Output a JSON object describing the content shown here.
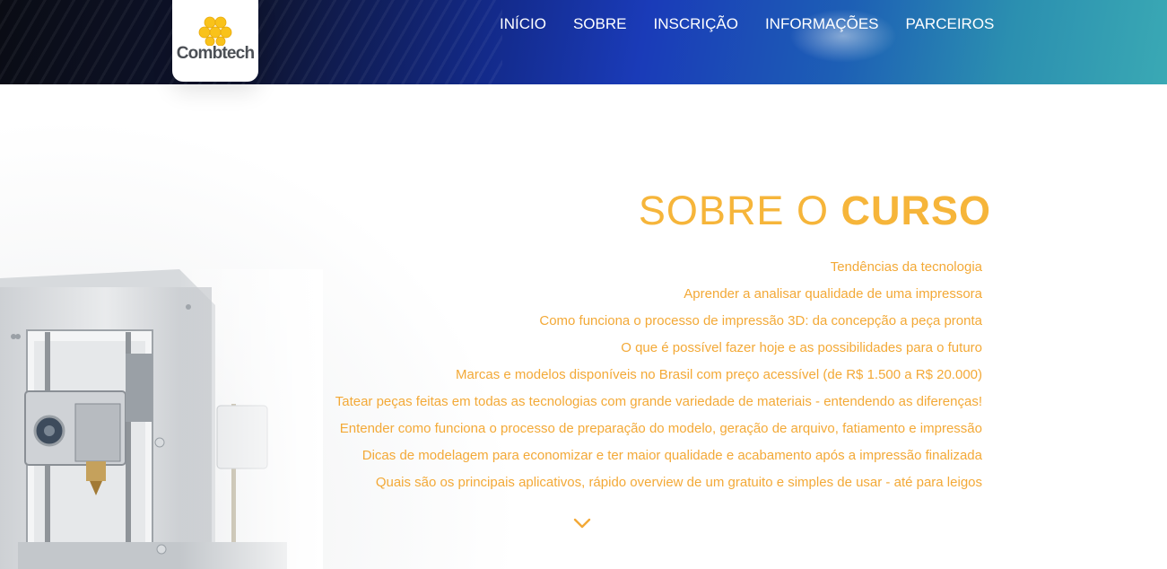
{
  "header": {
    "logo": {
      "text": "Combtech",
      "icon": "honeycomb-logo-icon",
      "accent_color": "#f9c21a"
    },
    "nav": [
      {
        "label": "INÍCIO"
      },
      {
        "label": "SOBRE"
      },
      {
        "label": "INSCRIÇÃO"
      },
      {
        "label": "INFORMAÇÕES"
      },
      {
        "label": "PARCEIROS"
      }
    ]
  },
  "about": {
    "title_light": "SOBRE O",
    "title_bold": "CURSO",
    "title_color": "#f6b53a",
    "topics": [
      "Tendências da tecnologia",
      "Aprender a analisar qualidade de uma impressora",
      "Como funciona o processo de impressão 3D: da concepção a peça pronta",
      "O que é possível fazer hoje e as possibilidades para o futuro",
      "Marcas e modelos disponíveis no Brasil com preço acessível (de R$ 1.500 a R$ 20.000)",
      "Tatear peças feitas em todas as tecnologias com grande variedade de materiais - entendendo as diferenças!",
      "Entender como funciona o processo de preparação do modelo, geração de arquivo, fatiamento e impressão",
      "Dicas de modelagem para economizar e ter maior qualidade e acabamento após a impressão finalizada",
      "Quais são os principais aplicativos, rápido overview de um gratuito e simples de usar - até para leigos"
    ],
    "scroll_icon": "chevron-down-icon"
  }
}
